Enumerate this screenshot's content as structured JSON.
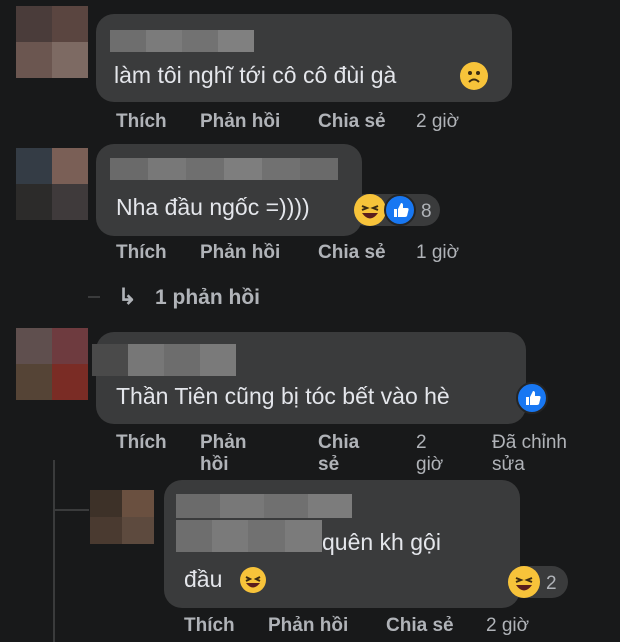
{
  "comments": [
    {
      "text": "làm tôi nghĩ tới cô cô đùi gà",
      "actions": {
        "like": "Thích",
        "reply": "Phản hồi",
        "share": "Chia sẻ",
        "time": "2 giờ"
      }
    },
    {
      "text": "Nha đầu ngốc =))))",
      "reactions_count": "8",
      "actions": {
        "like": "Thích",
        "reply": "Phản hồi",
        "share": "Chia sẻ",
        "time": "1 giờ"
      },
      "replies_link": "1 phản hồi"
    },
    {
      "text": "Thần Tiên cũng bị tóc bết vào hè",
      "actions": {
        "like_label": "Thích",
        "reply_line1": "Phản",
        "reply_line2": "hồi",
        "share_line1": "Chia",
        "share_line2": "sẻ",
        "time_line1": "2",
        "time_line2": "giờ",
        "edited_line1": "Đã chỉnh",
        "edited_line2": "sửa"
      }
    },
    {
      "text_line1": "quên kh gội",
      "text_line2": "đầu",
      "reactions_count": "2",
      "actions": {
        "like": "Thích",
        "reply": "Phản hồi",
        "share": "Chia sẻ",
        "time": "2 giờ"
      }
    }
  ],
  "reply_arrow": "↳",
  "colors": {
    "background": "#18191a",
    "bubble": "#3a3b3c",
    "meta": "#b0b3b8",
    "like_blue": "#1877f2",
    "emoji_yellow": "#f7c33a"
  }
}
